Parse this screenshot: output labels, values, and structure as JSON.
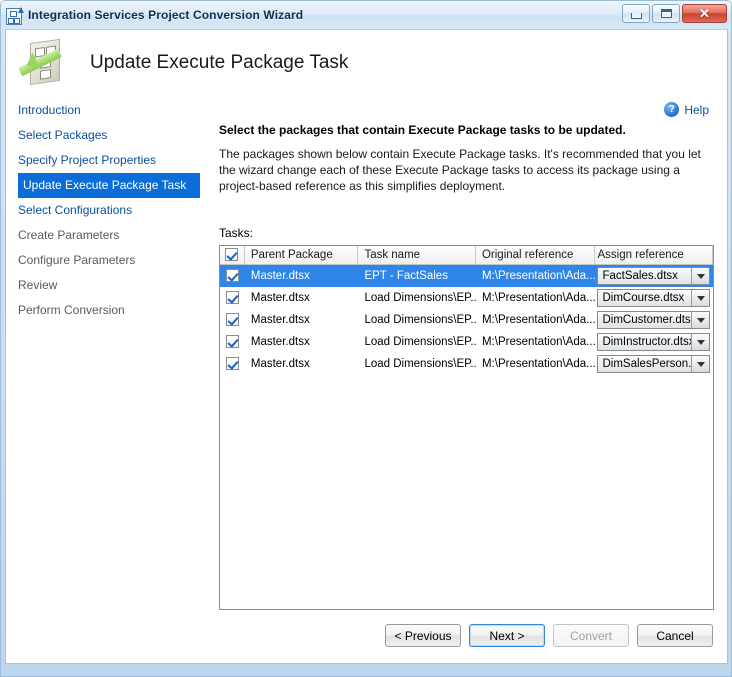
{
  "window": {
    "title": "Integration Services Project Conversion Wizard",
    "icon": "wizard-hierarchy-icon",
    "controls": {
      "minimize": "minimize-icon",
      "maximize": "maximize-icon",
      "close": "✕"
    }
  },
  "header": {
    "page_title": "Update Execute Package Task",
    "icon": "package-arrow-icon"
  },
  "help": {
    "label": "Help",
    "icon_glyph": "?"
  },
  "sidebar": {
    "items": [
      {
        "label": "Introduction",
        "state": "link"
      },
      {
        "label": "Select Packages",
        "state": "link"
      },
      {
        "label": "Specify Project Properties",
        "state": "link"
      },
      {
        "label": "Update Execute Package Task",
        "state": "active"
      },
      {
        "label": "Select Configurations",
        "state": "link"
      },
      {
        "label": "Create Parameters",
        "state": "disabled"
      },
      {
        "label": "Configure Parameters",
        "state": "disabled"
      },
      {
        "label": "Review",
        "state": "disabled"
      },
      {
        "label": "Perform Conversion",
        "state": "disabled"
      }
    ]
  },
  "main": {
    "heading": "Select the packages that contain Execute Package tasks to be updated.",
    "description": "The packages shown below contain Execute Package tasks. It's recommended that you let the wizard change each of these Execute Package tasks to access its package using a project-based reference as this simplifies deployment.",
    "tasks_label": "Tasks:"
  },
  "grid": {
    "columns": [
      {
        "key": "check",
        "label": ""
      },
      {
        "key": "parent",
        "label": "Parent Package"
      },
      {
        "key": "task",
        "label": "Task name"
      },
      {
        "key": "original",
        "label": "Original reference"
      },
      {
        "key": "assign",
        "label": "Assign reference"
      }
    ],
    "header_checkbox_checked": true,
    "rows": [
      {
        "checked": true,
        "parent": "Master.dtsx",
        "task": "EPT - FactSales",
        "original": "M:\\Presentation\\Ada...",
        "assign": "FactSales.dtsx",
        "selected": true
      },
      {
        "checked": true,
        "parent": "Master.dtsx",
        "task": "Load Dimensions\\EP...",
        "original": "M:\\Presentation\\Ada...",
        "assign": "DimCourse.dtsx",
        "selected": false
      },
      {
        "checked": true,
        "parent": "Master.dtsx",
        "task": "Load Dimensions\\EP...",
        "original": "M:\\Presentation\\Ada...",
        "assign": "DimCustomer.dtsx",
        "selected": false
      },
      {
        "checked": true,
        "parent": "Master.dtsx",
        "task": "Load Dimensions\\EP...",
        "original": "M:\\Presentation\\Ada...",
        "assign": "DimInstructor.dtsx",
        "selected": false
      },
      {
        "checked": true,
        "parent": "Master.dtsx",
        "task": "Load Dimensions\\EP...",
        "original": "M:\\Presentation\\Ada...",
        "assign": "DimSalesPerson....",
        "selected": false
      }
    ]
  },
  "footer": {
    "buttons": [
      {
        "label": "< Previous",
        "state": "normal"
      },
      {
        "label": "Next >",
        "state": "default"
      },
      {
        "label": "Convert",
        "state": "disabled"
      },
      {
        "label": "Cancel",
        "state": "normal"
      }
    ]
  },
  "colors": {
    "accent_blue": "#0b6ed8",
    "selection_blue": "#2f86e8",
    "link_blue": "#0b4f9e",
    "disabled_gray": "#5a5a5a"
  }
}
